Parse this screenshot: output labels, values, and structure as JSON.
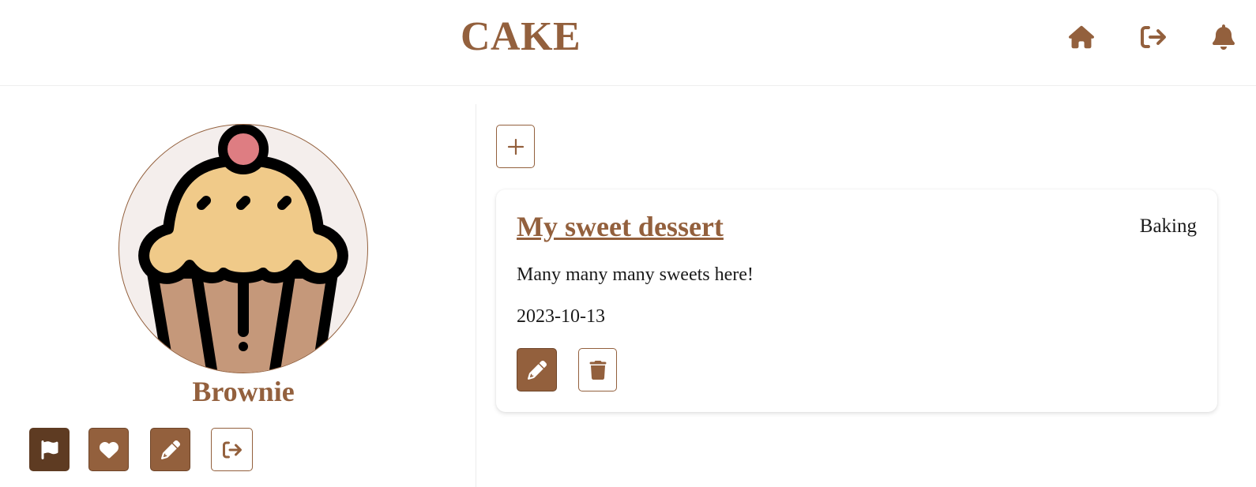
{
  "header": {
    "logo_text": "CAKE",
    "nav": [
      {
        "icon": "home-icon"
      },
      {
        "icon": "logout-icon"
      },
      {
        "icon": "bell-icon"
      }
    ]
  },
  "profile": {
    "avatar_icon": "cupcake-icon",
    "name": "Brownie",
    "actions": [
      {
        "icon": "flag-icon",
        "style": "dark"
      },
      {
        "icon": "heart-icon",
        "style": "brown"
      },
      {
        "icon": "pencil-icon",
        "style": "brown"
      },
      {
        "icon": "logout-icon",
        "style": "outline"
      }
    ]
  },
  "posts": {
    "add_icon": "plus-icon",
    "items": [
      {
        "title": "My sweet dessert",
        "category": "Baking",
        "description": "Many many many sweets here!",
        "date": "2023-10-13",
        "edit_icon": "pencil-icon",
        "delete_icon": "trash-icon"
      }
    ]
  },
  "colors": {
    "brand": "#93603d",
    "brand_dark": "#5e3b22",
    "avatar_bg": "#f4eeec",
    "text": "#1a1a1a"
  }
}
